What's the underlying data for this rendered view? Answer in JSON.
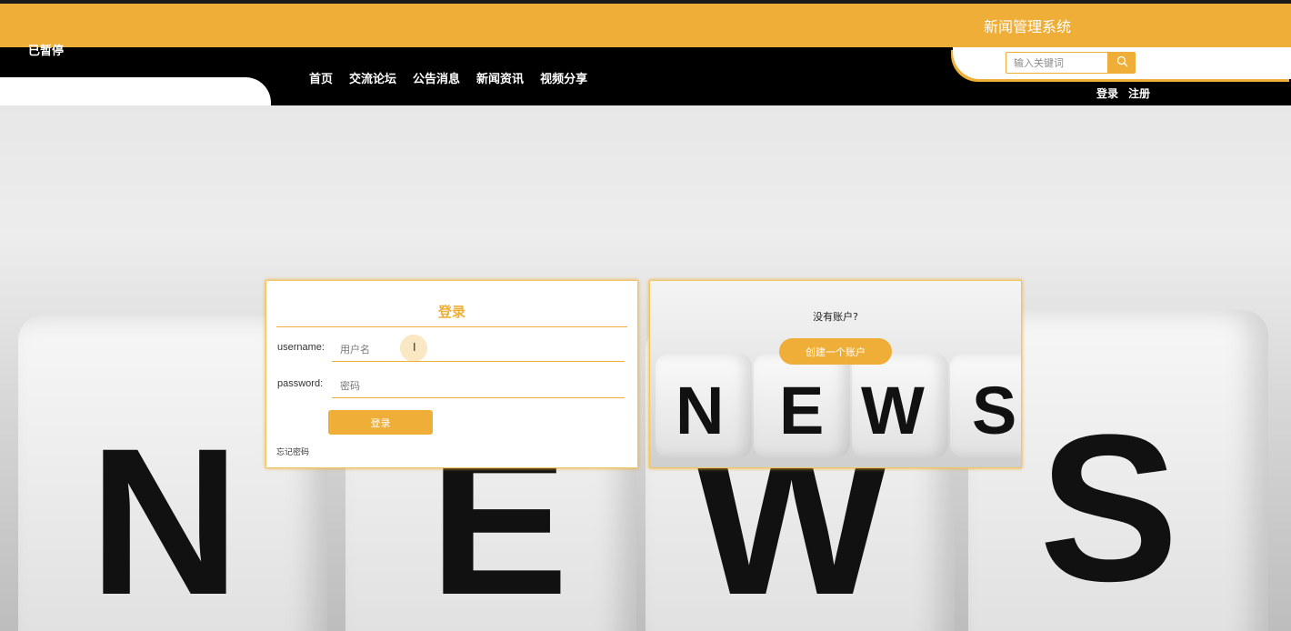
{
  "brand": {
    "title": "新闻管理系统",
    "accent": "#eeae38"
  },
  "overlay": {
    "paused_label": "已暂停"
  },
  "nav": {
    "items": [
      {
        "label": "首页"
      },
      {
        "label": "交流论坛"
      },
      {
        "label": "公告消息"
      },
      {
        "label": "新闻资讯"
      },
      {
        "label": "视频分享"
      }
    ]
  },
  "search": {
    "placeholder": "输入关键词",
    "icon": "search-icon"
  },
  "auth": {
    "login_label": "登录",
    "register_label": "注册"
  },
  "hero": {
    "letters": [
      "N",
      "E",
      "W",
      "S"
    ]
  },
  "login_form": {
    "title": "登录",
    "username_label": "username:",
    "username_placeholder": "用户名",
    "password_label": "password:",
    "password_placeholder": "密码",
    "submit_label": "登录",
    "forgot_label": "忘记密码"
  },
  "register_panel": {
    "question": "没有账户?",
    "button_label": "创建一个账户",
    "letters": [
      "N",
      "E",
      "W",
      "S"
    ]
  }
}
